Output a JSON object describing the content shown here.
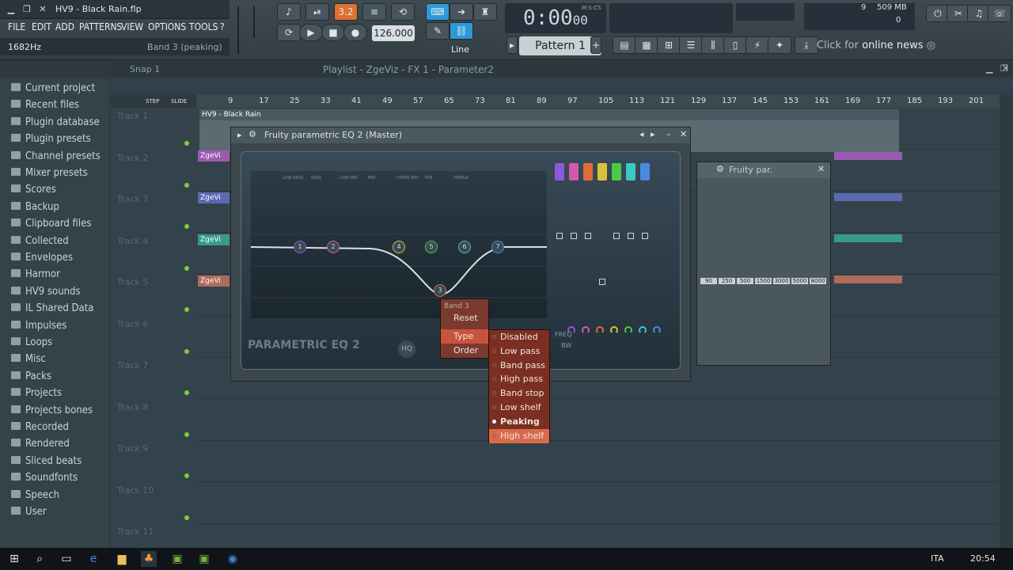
{
  "window": {
    "title": "HV9 - Black Rain.flp"
  },
  "menu": [
    "FILE",
    "EDIT",
    "ADD",
    "PATTERNS",
    "VIEW",
    "OPTIONS",
    "TOOLS",
    "?"
  ],
  "hint": {
    "value": "1682Hz",
    "target": "Band 3 (peaking)"
  },
  "transport": {
    "time": "0:00",
    "time_small": "00",
    "time_label": "M:S:CS",
    "tempo": "126.000",
    "snap_mode": "Line",
    "pattern": "Pattern 1"
  },
  "cpu": {
    "value": "9",
    "mem": "509 MB",
    "poly": "0"
  },
  "news": {
    "prefix": "Click for",
    "text": "online news"
  },
  "playlist": {
    "snap": "Snap 1",
    "title": "Playlist - ZgeViz - FX 1 - Parameter2",
    "step_label": "STEP",
    "slide_label": "SLIDE"
  },
  "ruler": [
    "9",
    "17",
    "25",
    "33",
    "41",
    "49",
    "57",
    "65",
    "73",
    "81",
    "89",
    "97",
    "105",
    "113",
    "121",
    "129",
    "137",
    "145",
    "153",
    "161",
    "169",
    "177",
    "185",
    "193",
    "201"
  ],
  "browser": [
    {
      "label": "Current project",
      "icon": "project-icon"
    },
    {
      "label": "Recent files",
      "icon": "recent-icon"
    },
    {
      "label": "Plugin database",
      "icon": "plugin-icon"
    },
    {
      "label": "Plugin presets",
      "icon": "preset-icon"
    },
    {
      "label": "Channel presets",
      "icon": "preset-icon"
    },
    {
      "label": "Mixer presets",
      "icon": "mixer-icon"
    },
    {
      "label": "Scores",
      "icon": "note-icon"
    },
    {
      "label": "Backup",
      "icon": "folder-icon"
    },
    {
      "label": "Clipboard files",
      "icon": "folder-icon"
    },
    {
      "label": "Collected",
      "icon": "folder-icon"
    },
    {
      "label": "Envelopes",
      "icon": "folder-icon"
    },
    {
      "label": "Harmor",
      "icon": "folder-icon"
    },
    {
      "label": "HV9 sounds",
      "icon": "folder-icon"
    },
    {
      "label": "IL Shared Data",
      "icon": "folder-icon"
    },
    {
      "label": "Impulses",
      "icon": "folder-icon"
    },
    {
      "label": "Loops",
      "icon": "folder-icon"
    },
    {
      "label": "Misc",
      "icon": "folder-icon"
    },
    {
      "label": "Packs",
      "icon": "folder-icon"
    },
    {
      "label": "Projects",
      "icon": "folder-icon"
    },
    {
      "label": "Projects bones",
      "icon": "folder-icon"
    },
    {
      "label": "Recorded",
      "icon": "folder-icon"
    },
    {
      "label": "Rendered",
      "icon": "folder-icon"
    },
    {
      "label": "Sliced beats",
      "icon": "sliced-icon"
    },
    {
      "label": "Soundfonts",
      "icon": "folder-icon"
    },
    {
      "label": "Speech",
      "icon": "folder-icon"
    },
    {
      "label": "User",
      "icon": "user-icon"
    }
  ],
  "tracks": [
    "Track 1",
    "Track 2",
    "Track 3",
    "Track 4",
    "Track 5",
    "Track 6",
    "Track 7",
    "Track 8",
    "Track 9",
    "Track 10",
    "Track 11"
  ],
  "clips": {
    "audio": "HV9 - Black Rain",
    "zge": "ZgeVi"
  },
  "eq": {
    "title": "Fruity parametric EQ 2 (Master)",
    "logo": "PARAMETRIC EQ 2",
    "hq_label": "HQ",
    "freq_label": "FREQ",
    "bw_label": "BW",
    "band_labels": [
      "LOW BASS",
      "BASS",
      "LOW MID",
      "MID",
      "UPPER MID",
      "PRE",
      "TREBLE"
    ],
    "band_nums": [
      "1",
      "2",
      "3",
      "4",
      "5",
      "6",
      "7"
    ],
    "band_colors": [
      "#8a5ad8",
      "#d05ab0",
      "#e06a3a",
      "#d8c23a",
      "#4ac84a",
      "#3ac8c8",
      "#4a8ae0"
    ]
  },
  "mini_eq": {
    "title": "Fruity par.",
    "freqs": [
      "90",
      "250",
      "500",
      "1500",
      "3000",
      "5000",
      "8000"
    ]
  },
  "context_menu": {
    "header": "Band 3",
    "items": [
      "Reset",
      "Type",
      "Order"
    ]
  },
  "type_menu": {
    "items": [
      "Disabled",
      "Low pass",
      "Band pass",
      "High pass",
      "Band stop",
      "Low shelf",
      "Peaking",
      "High shelf"
    ],
    "selected": "Peaking",
    "hovered": "High shelf"
  },
  "taskbar": {
    "lang": "ITA",
    "time": "20:54"
  }
}
